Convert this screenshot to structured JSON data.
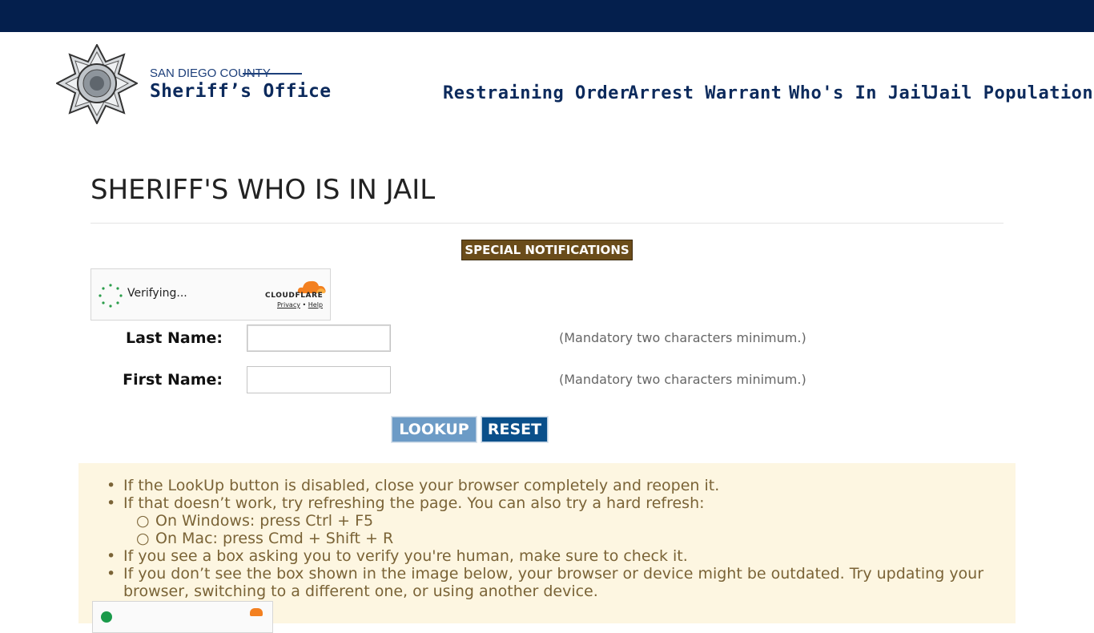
{
  "header": {
    "logo": {
      "line1": "SAN DIEGO COUNTY",
      "line2": "Sheriff’s Office"
    },
    "nav": [
      {
        "label": "Restraining Order"
      },
      {
        "label": "Arrest Warrant"
      },
      {
        "label": "Who's In Jail"
      },
      {
        "label": "Jail Population"
      }
    ],
    "colors": {
      "topbar": "#041f4d",
      "nav_text": "#0c2a5c"
    }
  },
  "main": {
    "title": "SHERIFF'S WHO IS IN JAIL",
    "special_notifications_label": "SPECIAL NOTIFICATIONS",
    "captcha": {
      "status": "Verifying...",
      "brand": "CLOUDFLARE",
      "privacy": "Privacy",
      "separator": "•",
      "help": "Help"
    },
    "form": {
      "last_name": {
        "label": "Last Name:",
        "value": "",
        "hint": "(Mandatory two characters minimum.)"
      },
      "first_name": {
        "label": "First Name:",
        "value": "",
        "hint": "(Mandatory two characters minimum.)"
      },
      "lookup_label": "LOOKUP",
      "reset_label": "RESET"
    },
    "notice": {
      "items": [
        "If the LookUp button is disabled, close your browser completely and reopen it.",
        "If that doesn’t work, try refreshing the page. You can also try a hard refresh:",
        "On Windows: press Ctrl + F5",
        "On Mac: press Cmd + Shift + R",
        "If you see a box asking you to verify you're human, make sure to check it.",
        "If you don’t see the box shown in the image below, your browser or device might be outdated. Try updating your",
        "browser, switching to a different one, or using another device."
      ],
      "bullet": "•",
      "sub_bullet": "○"
    }
  }
}
